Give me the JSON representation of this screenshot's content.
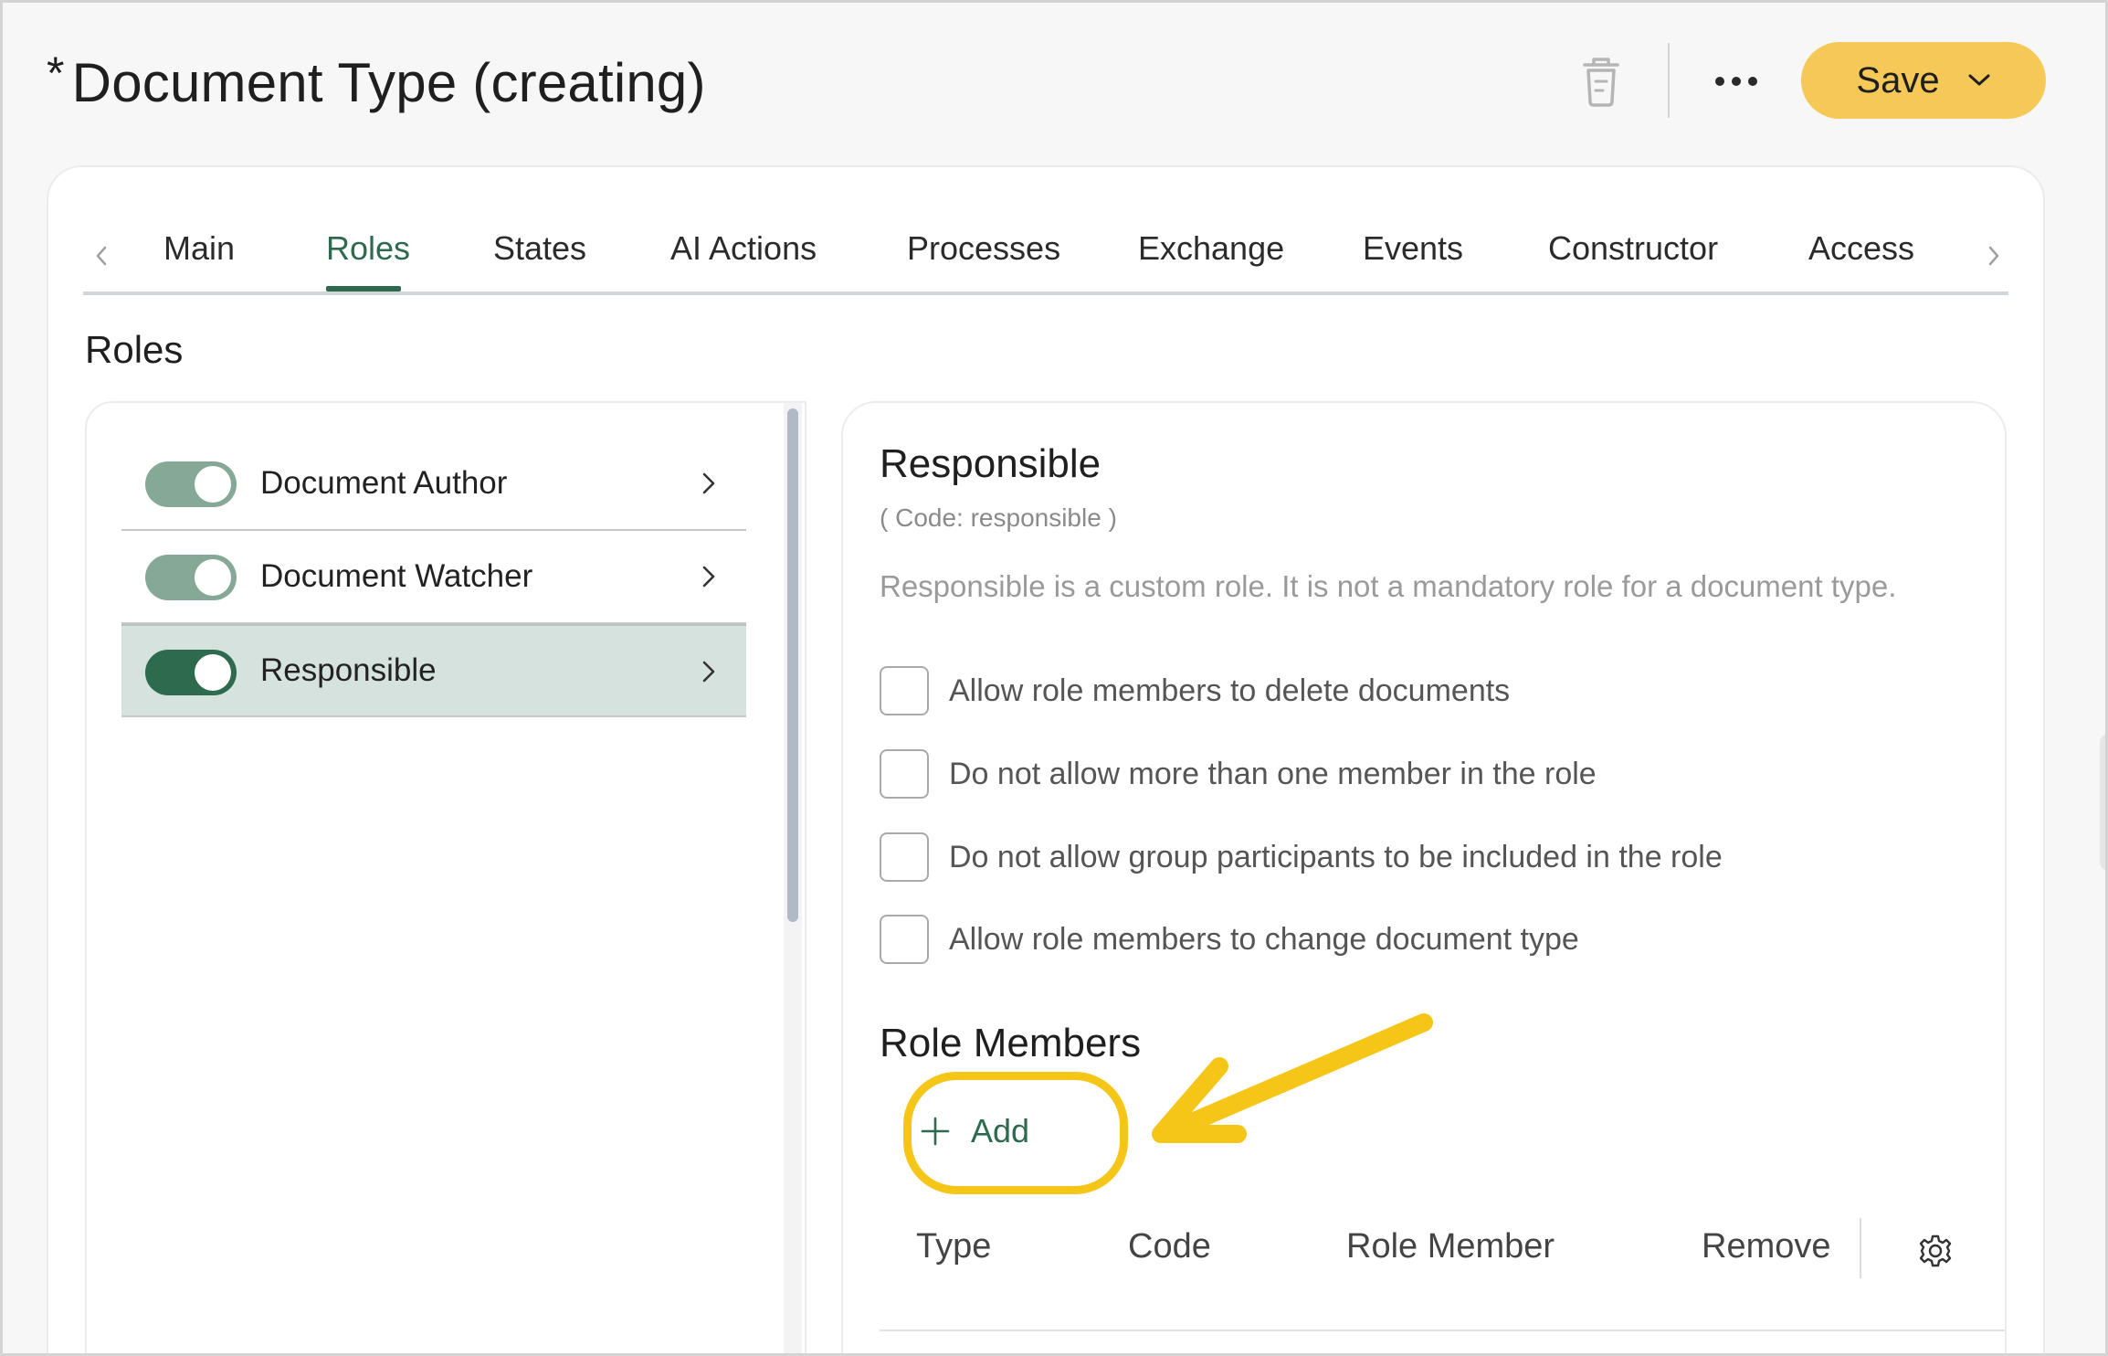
{
  "page": {
    "title_marker": "*",
    "title": "Document Type (creating)"
  },
  "toolbar": {
    "delete_icon": "trash-icon",
    "more_icon": "more-horizontal-icon",
    "save_label": "Save",
    "save_menu_icon": "chevron-down-icon"
  },
  "tabs": {
    "items": [
      {
        "label": "Main",
        "active": false
      },
      {
        "label": "Roles",
        "active": true
      },
      {
        "label": "States",
        "active": false
      },
      {
        "label": "AI Actions",
        "active": false
      },
      {
        "label": "Processes",
        "active": false
      },
      {
        "label": "Exchange",
        "active": false
      },
      {
        "label": "Events",
        "active": false
      },
      {
        "label": "Constructor",
        "active": false
      },
      {
        "label": "Access",
        "active": false
      }
    ],
    "prev_icon": "chevron-left-icon",
    "next_icon": "chevron-right-icon"
  },
  "section": {
    "title": "Roles"
  },
  "roles": {
    "items": [
      {
        "label": "Document Author",
        "enabled": true,
        "selected": false
      },
      {
        "label": "Document Watcher",
        "enabled": true,
        "selected": false
      },
      {
        "label": "Responsible",
        "enabled": true,
        "selected": true
      }
    ]
  },
  "detail": {
    "title": "Responsible",
    "code": "( Code: responsible )",
    "description": "Responsible is a custom role. It is not a mandatory role for a document type.",
    "options": [
      {
        "label": "Allow role members to delete documents",
        "checked": false
      },
      {
        "label": "Do not allow more than one member in the role",
        "checked": false
      },
      {
        "label": "Do not allow group participants to be included in the role",
        "checked": false
      },
      {
        "label": "Allow role members to change document type",
        "checked": false
      }
    ]
  },
  "members": {
    "title": "Role Members",
    "add_label": "Add",
    "add_icon": "plus-icon",
    "columns": [
      "Type",
      "Code",
      "Role Member",
      "Remove"
    ],
    "settings_icon": "gear-icon"
  },
  "colors": {
    "accent": "#2e6b4e",
    "save": "#f6c857",
    "highlight": "#f5c518",
    "selected_row": "#d6e2dd"
  }
}
